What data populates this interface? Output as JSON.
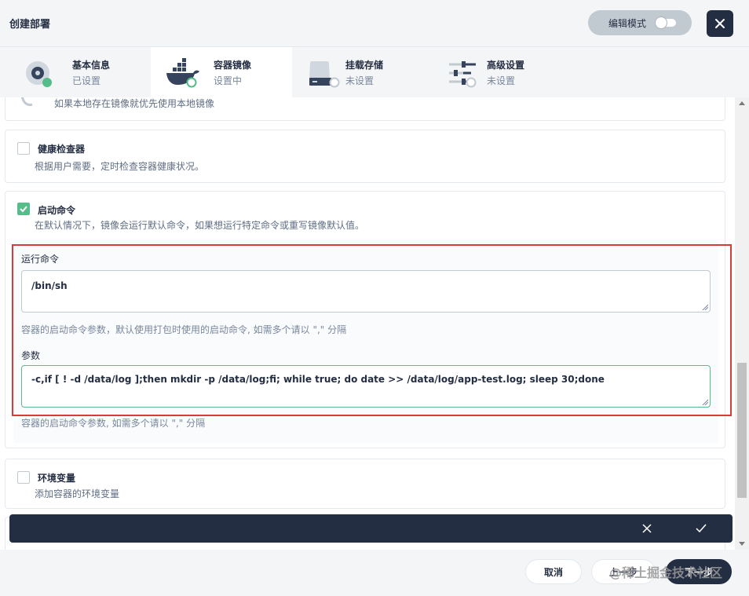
{
  "header": {
    "title": "创建部署",
    "edit_mode_label": "编辑模式"
  },
  "tabs": [
    {
      "title": "基本信息",
      "status": "已设置"
    },
    {
      "title": "容器镜像",
      "status": "设置中"
    },
    {
      "title": "挂载存储",
      "status": "未设置"
    },
    {
      "title": "高级设置",
      "status": "未设置"
    }
  ],
  "cards": {
    "local_image": {
      "desc": "如果本地存在镜像就优先使用本地镜像"
    },
    "health_check": {
      "title": "健康检查器",
      "desc": "根据用户需要，定时检查容器健康状况。",
      "checked": false
    },
    "start_command": {
      "title": "启动命令",
      "desc": "在默认情况下，镜像会运行默认命令，如果想运行特定命令或重写镜像默认值。",
      "checked": true,
      "run_command": {
        "label": "运行命令",
        "value": "/bin/sh",
        "hint": "容器的启动命令参数，默认使用打包时使用的启动命令, 如需多个请以 \",\" 分隔"
      },
      "params": {
        "label": "参数",
        "value": "-c,if [ ! -d /data/log ];then mkdir -p /data/log;fi; while true; do date >> /data/log/app-test.log; sleep 30;done",
        "hint": "容器的启动命令参数, 如需多个请以 \",\" 分隔"
      }
    },
    "env": {
      "title": "环境变量",
      "desc": "添加容器的环境变量",
      "checked": false
    }
  },
  "footer": {
    "cancel_label": "取消",
    "prev_label": "上一步",
    "next_label": "下一步",
    "watermark": "@稀土掘金技术社区"
  },
  "colors": {
    "accent": "#55bc8a",
    "dark": "#242e42",
    "highlight": "#d93b3b"
  }
}
